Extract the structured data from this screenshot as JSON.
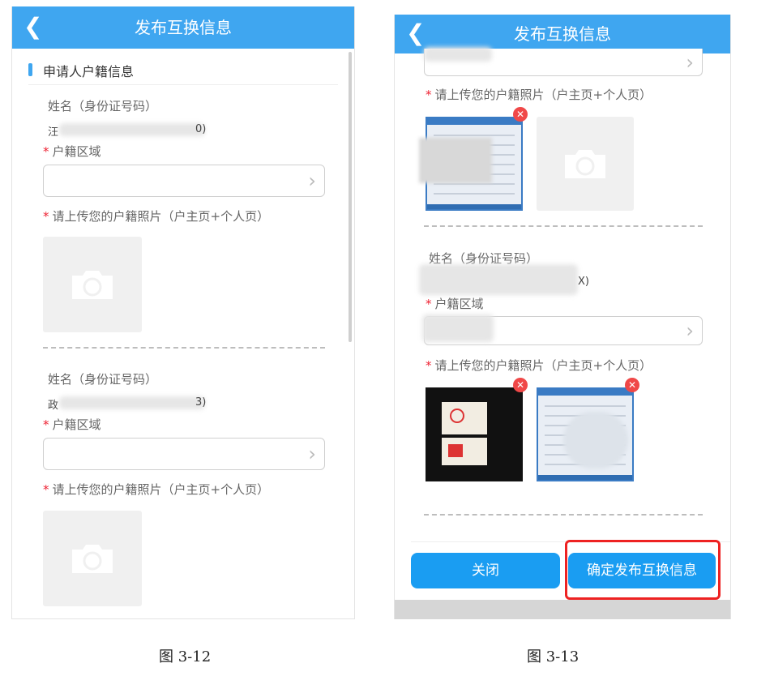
{
  "fig1": {
    "title": "发布互换信息",
    "back_icon": "chevron-left-icon",
    "section_title": "申请人户籍信息",
    "entries": [
      {
        "name_label": "姓名（身份证号码）",
        "name_value_start": "汪",
        "name_value_end": "0)",
        "region_label": "户籍区域",
        "photo_label": "请上传您的户籍照片（户主页+个人页）"
      },
      {
        "name_label": "姓名（身份证号码）",
        "name_value_start": "政",
        "name_value_end": "3)",
        "region_label": "户籍区域",
        "photo_label": "请上传您的户籍照片（户主页+个人页）"
      }
    ],
    "caption": "图 3-12"
  },
  "fig2": {
    "title": "发布互换信息",
    "back_icon": "chevron-left-icon",
    "photo_label_1": "请上传您的户籍照片（户主页+个人页）",
    "name_label": "姓名（身份证号码）",
    "name_value_end": "X)",
    "region_label": "户籍区域",
    "photo_label_2": "请上传您的户籍照片（户主页+个人页）",
    "close_button": "关闭",
    "confirm_button": "确定发布互换信息",
    "caption": "图 3-13"
  },
  "colors": {
    "titlebar": "#3fa6f0",
    "button": "#1a9df2",
    "required": "#e22233",
    "highlight": "#e22222"
  }
}
